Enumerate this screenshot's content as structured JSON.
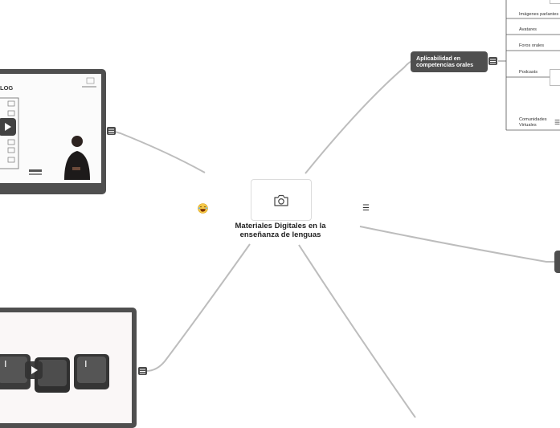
{
  "central": {
    "title": "Materiales Digitales en la enseñanza de lenguas",
    "image_icon": "camera-icon",
    "emoji_icon": "laughing-face-icon"
  },
  "topic": {
    "label": "Aplicabilidad en competencias orales"
  },
  "subtopics": [
    {
      "label": "Imágenes parlantes"
    },
    {
      "label": "Avatares"
    },
    {
      "label": "Foros orales"
    },
    {
      "label": "Podcasts"
    },
    {
      "label": "Comunidades Virtuales"
    }
  ],
  "video_cards": [
    {
      "caption": "logs",
      "thumb_text": "LOG"
    },
    {
      "caption": ""
    }
  ],
  "colors": {
    "dark": "#4f4f4f",
    "line": "#b5b5b5",
    "background": "#ffffff"
  }
}
